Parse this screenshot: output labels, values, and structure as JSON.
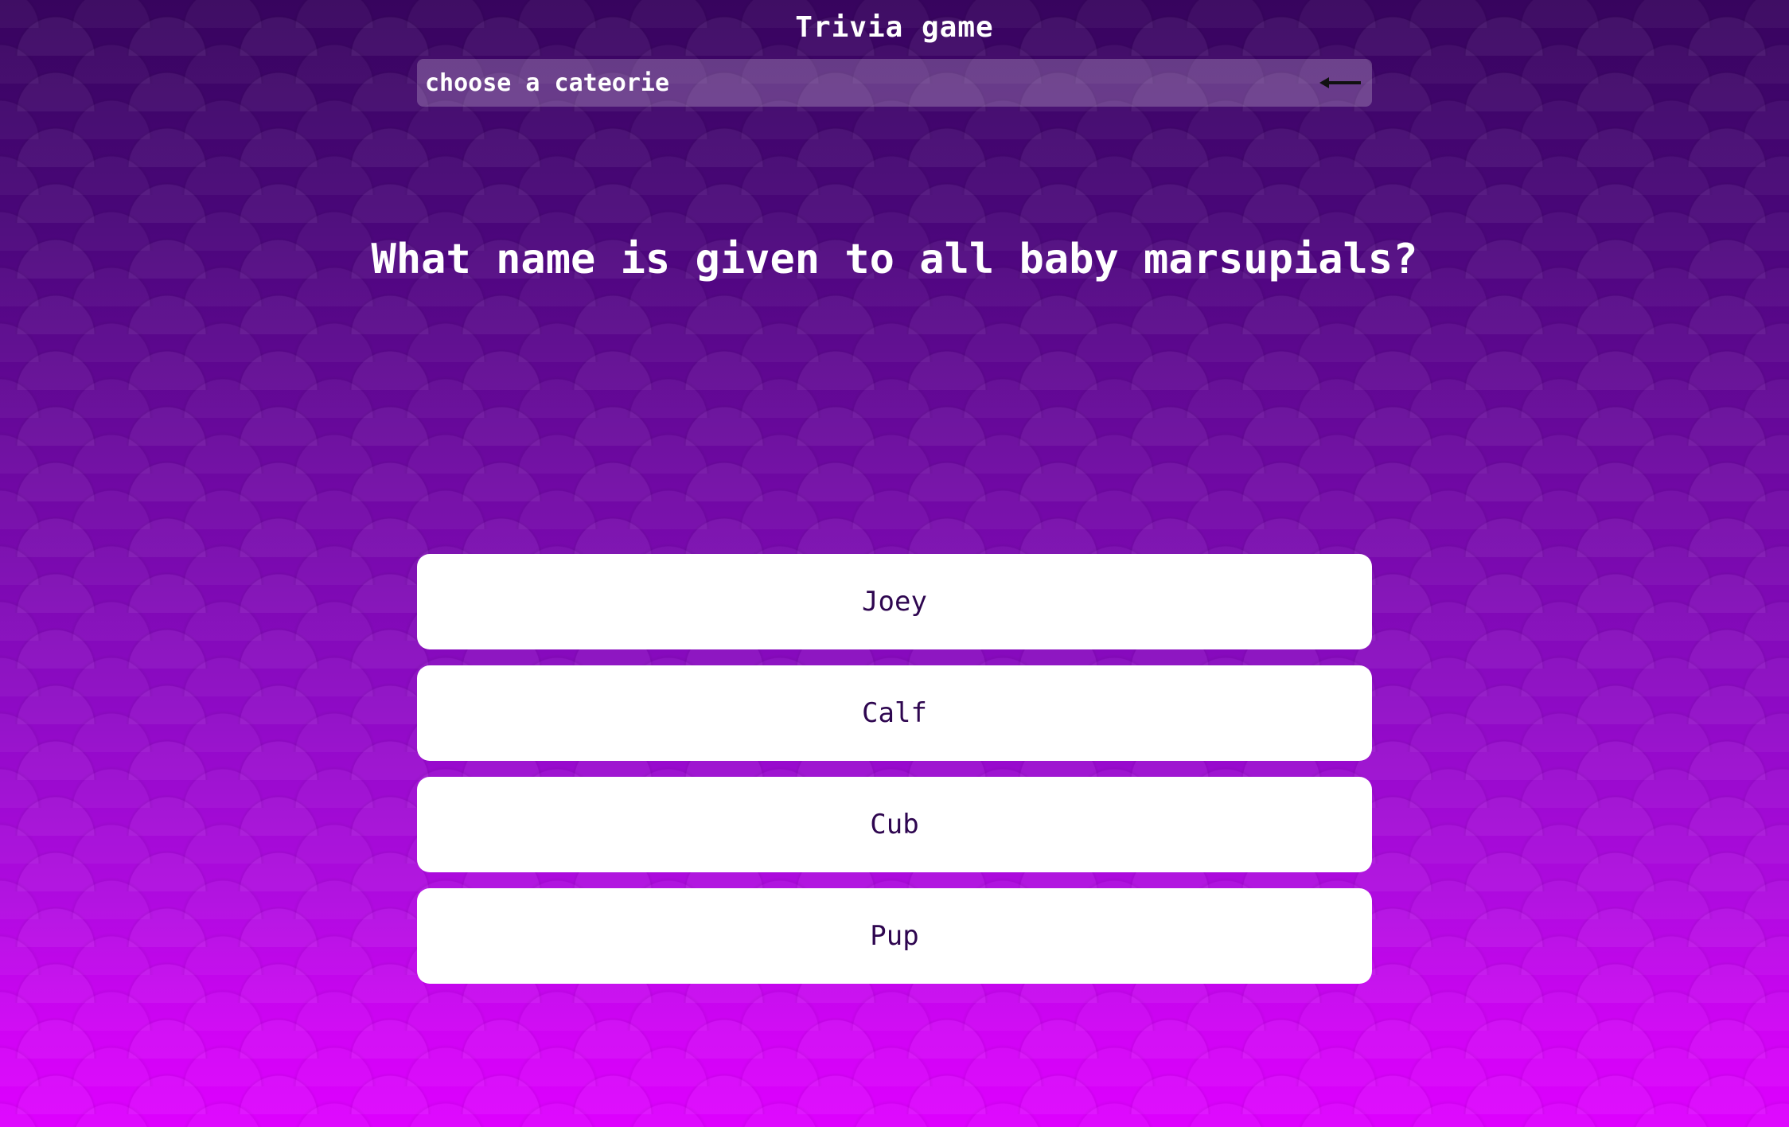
{
  "app": {
    "title": "Trivia game"
  },
  "category_select": {
    "label": "choose a cateorie",
    "icon": "back-arrow-icon"
  },
  "question": {
    "text": "What name is given to all baby marsupials?"
  },
  "answers": [
    {
      "label": "Joey"
    },
    {
      "label": "Calf"
    },
    {
      "label": "Cub"
    },
    {
      "label": "Pup"
    }
  ],
  "colors": {
    "background_top": "#37045e",
    "background_bottom": "#de00ff",
    "answer_text": "#2e0650",
    "answer_bg": "#ffffff"
  }
}
